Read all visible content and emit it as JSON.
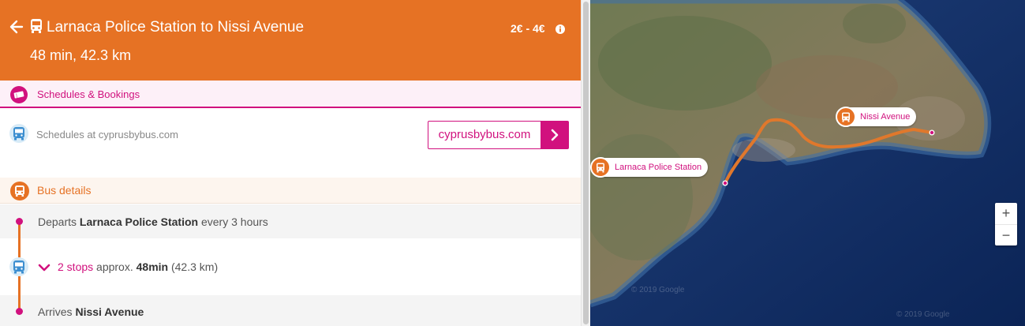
{
  "header": {
    "title": "Larnaca Police Station to Nissi Avenue",
    "summary": "48 min, 42.3 km",
    "price": "2€ - 4€"
  },
  "schedules": {
    "section_title": "Schedules & Bookings",
    "text": "Schedules at cyprusbybus.com",
    "button_label": "cyprusbybus.com"
  },
  "bus_details": {
    "section_title": "Bus details",
    "depart_prefix": "Departs",
    "depart_stop": "Larnaca Police Station",
    "depart_suffix": "every 3 hours",
    "stops_link": "2 stops",
    "approx": "approx.",
    "duration": "48min",
    "distance": "(42.3 km)",
    "arrive_prefix": "Arrives",
    "arrive_stop": "Nissi Avenue"
  },
  "map": {
    "start_label": "Larnaca Police Station",
    "end_label": "Nissi Avenue",
    "zoom_in": "+",
    "zoom_out": "−",
    "attribution_1": "© 2019 Google",
    "attribution_2": "© 2019 Google"
  },
  "colors": {
    "brand_orange": "#e67224",
    "brand_magenta": "#d1117e",
    "route_line": "#e0782c"
  }
}
